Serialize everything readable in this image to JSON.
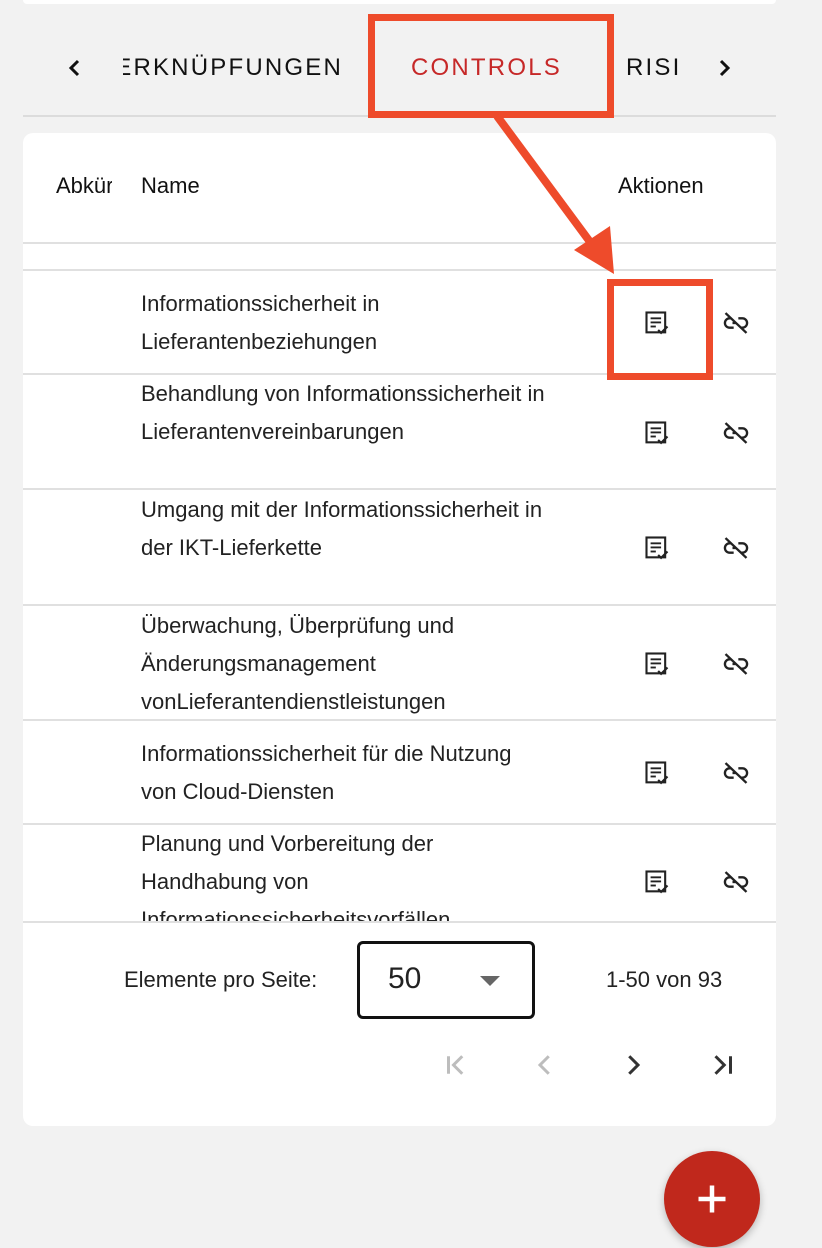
{
  "tabs": {
    "items": [
      {
        "label": "VERKNÜPFUNGEN"
      },
      {
        "label": "CONTROLS"
      },
      {
        "label": "RISIKEN"
      }
    ]
  },
  "table": {
    "headers": {
      "abbr": "Abkürzung",
      "name": "Name",
      "actions": "Aktionen"
    },
    "rows": [
      {
        "name": "Informationssicherheit in Lieferantenbeziehungen"
      },
      {
        "name": "Behandlung von Informationssicherheit in Lieferantenvereinbarungen"
      },
      {
        "name": "Umgang mit der Informationssicherheit in der IKT-Lieferkette"
      },
      {
        "name": "Überwachung, Überprüfung und Änderungsmanagement vonLieferantendienstleistungen"
      },
      {
        "name": "Informationssicherheit für die Nutzung von Cloud-Diensten"
      },
      {
        "name": "Planung und Vorbereitung der Handhabung von Informationssicherheitsvorfällen"
      }
    ]
  },
  "paginator": {
    "items_per_page_label": "Elemente pro Seite:",
    "page_size": "50",
    "range_label": "1-50 von 93"
  },
  "colors": {
    "accent": "#c62828",
    "annotation": "#ee4b2b",
    "fab": "#c0281c"
  },
  "icons": {
    "row_action_1": "assignment-review-icon",
    "row_action_2": "link-off-icon",
    "fab": "add-icon"
  }
}
